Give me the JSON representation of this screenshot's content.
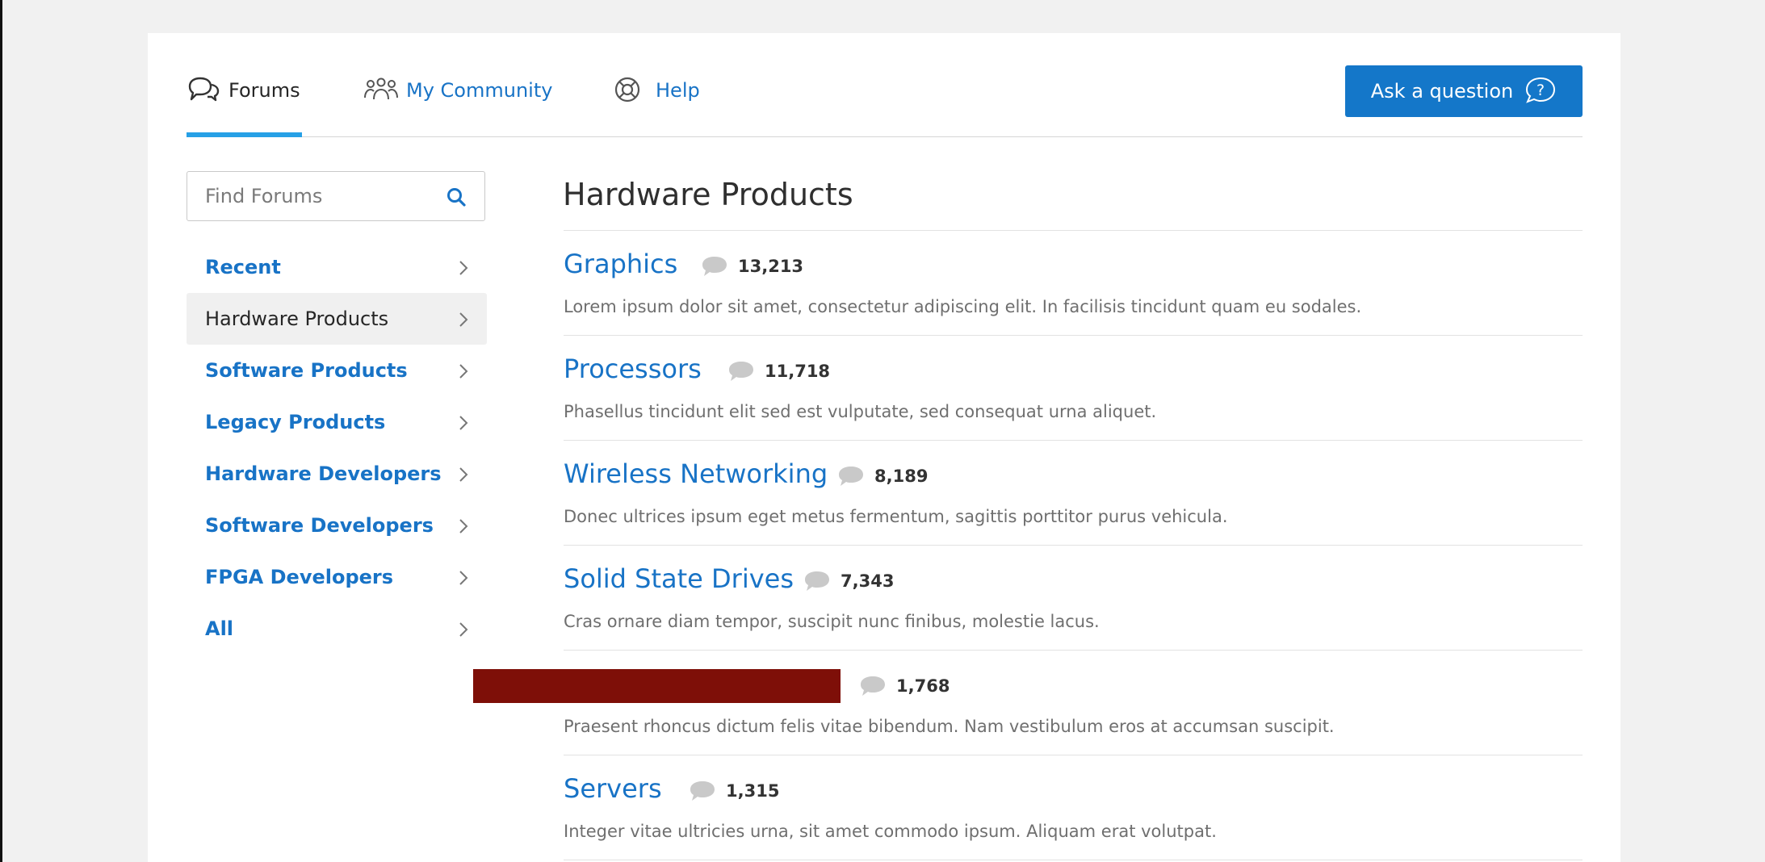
{
  "nav": {
    "tabs": [
      {
        "label": "Forums",
        "icon": "chat-bubbles-icon",
        "active": true
      },
      {
        "label": "My Community",
        "icon": "people-group-icon",
        "active": false
      },
      {
        "label": "Help",
        "icon": "lifebuoy-icon",
        "active": false
      }
    ],
    "ask_button": {
      "label": "Ask a question",
      "icon": "question-circle-icon"
    }
  },
  "sidebar": {
    "search": {
      "placeholder": "Find Forums",
      "value": ""
    },
    "items": [
      {
        "label": "Recent"
      },
      {
        "label": "Hardware Products",
        "active": true
      },
      {
        "label": "Software Products"
      },
      {
        "label": "Legacy Products"
      },
      {
        "label": "Hardware Developers"
      },
      {
        "label": "Software Developers"
      },
      {
        "label": "FPGA Developers"
      },
      {
        "label": "All"
      }
    ]
  },
  "main": {
    "title": "Hardware Products",
    "forums": [
      {
        "name": "Graphics",
        "count": "13,213",
        "description": "Lorem ipsum dolor sit amet, consectetur adipiscing elit. In facilisis tincidunt quam eu sodales."
      },
      {
        "name": "Processors",
        "count": "11,718",
        "description": "Phasellus tincidunt elit sed est vulputate, sed consequat urna aliquet."
      },
      {
        "name": "Wireless Networking",
        "count": "8,189",
        "description": "Donec ultrices ipsum eget metus fermentum, sagittis porttitor purus vehicula."
      },
      {
        "name": "Solid State Drives",
        "count": "7,343",
        "description": "Cras ornare diam tempor, suscipit nunc finibus, molestie lacus."
      },
      {
        "name": "",
        "count": "1,768",
        "description": "Praesent rhoncus dictum felis vitae bibendum. Nam vestibulum eros at accumsan suscipit."
      },
      {
        "name": "Servers",
        "count": "1,315",
        "description": "Integer vitae ultricies urna, sit amet commodo ipsum. Aliquam erat volutpat."
      }
    ]
  },
  "colors": {
    "accent": "#1873c6",
    "button": "#1477c9",
    "tab_underline": "#26a0e6",
    "redaction": "#7e0f08"
  }
}
